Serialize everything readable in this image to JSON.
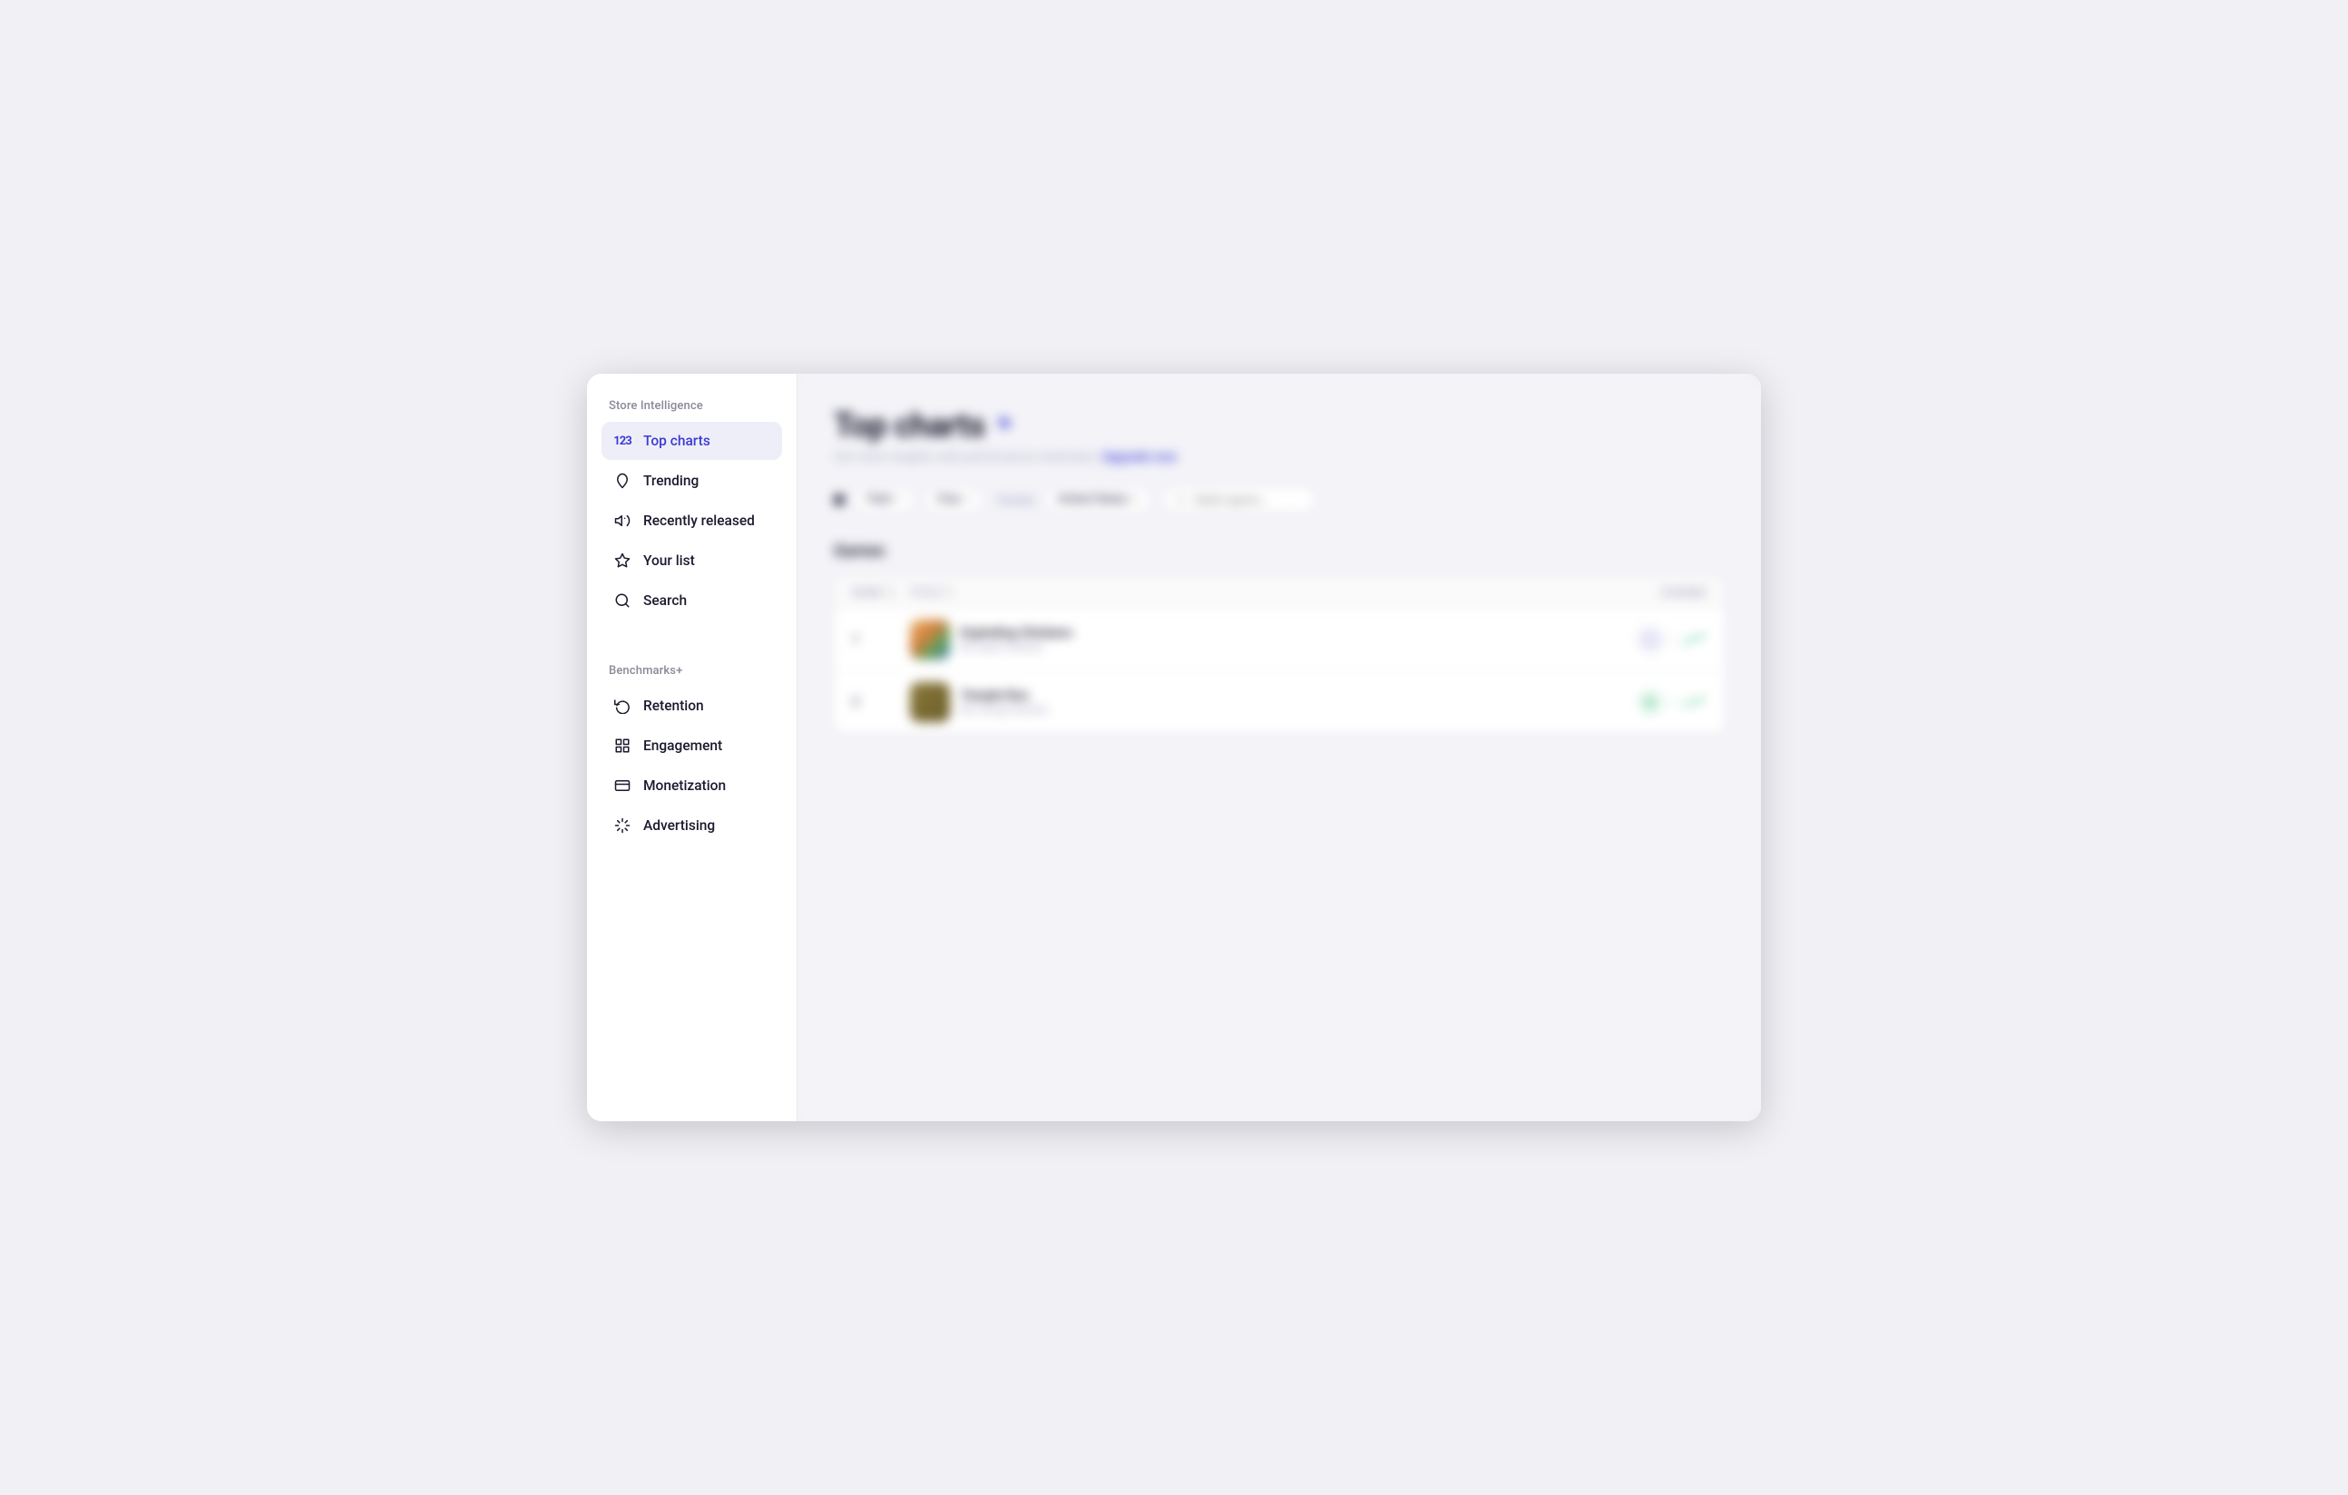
{
  "sidebar": {
    "section_label_1": "Store Intelligence",
    "section_label_2": "Benchmarks+",
    "nav_items": [
      {
        "id": "top-charts",
        "label": "Top charts",
        "icon": "123",
        "active": true
      },
      {
        "id": "trending",
        "label": "Trending",
        "icon": "🔥"
      },
      {
        "id": "recently-released",
        "label": "Recently released",
        "icon": "📢"
      },
      {
        "id": "your-list",
        "label": "Your list",
        "icon": "☆"
      },
      {
        "id": "search",
        "label": "Search",
        "icon": "🔍"
      }
    ],
    "benchmark_items": [
      {
        "id": "retention",
        "label": "Retention",
        "icon": "↩"
      },
      {
        "id": "engagement",
        "label": "Engagement",
        "icon": "▦"
      },
      {
        "id": "monetization",
        "label": "Monetization",
        "icon": "▬"
      },
      {
        "id": "advertising",
        "label": "Advertising",
        "icon": "✳"
      }
    ]
  },
  "main": {
    "page_title": "Top charts",
    "page_title_icon": "#",
    "page_subtitle": "Get more insights with performance estimates.",
    "upgrade_link_label": "Upgrade now",
    "filters": {
      "type_label": "Paid",
      "chart_label": "Free",
      "country_label": "Country",
      "country_value": "United States",
      "genre_placeholder": "Select genre..."
    },
    "section_games_label": "Games",
    "table_columns": {
      "rank": "Rank",
      "title": "Title",
      "change": "Change"
    },
    "table_rows": [
      {
        "rank": "1",
        "app_name": "Exploding Chickens",
        "developer": "By Super Studios",
        "change_direction": "up",
        "icon_style": "1"
      },
      {
        "rank": "2",
        "app_name": "Temple Run",
        "developer": "By Imangi Studios",
        "change_direction": "up",
        "icon_style": "2"
      }
    ]
  }
}
